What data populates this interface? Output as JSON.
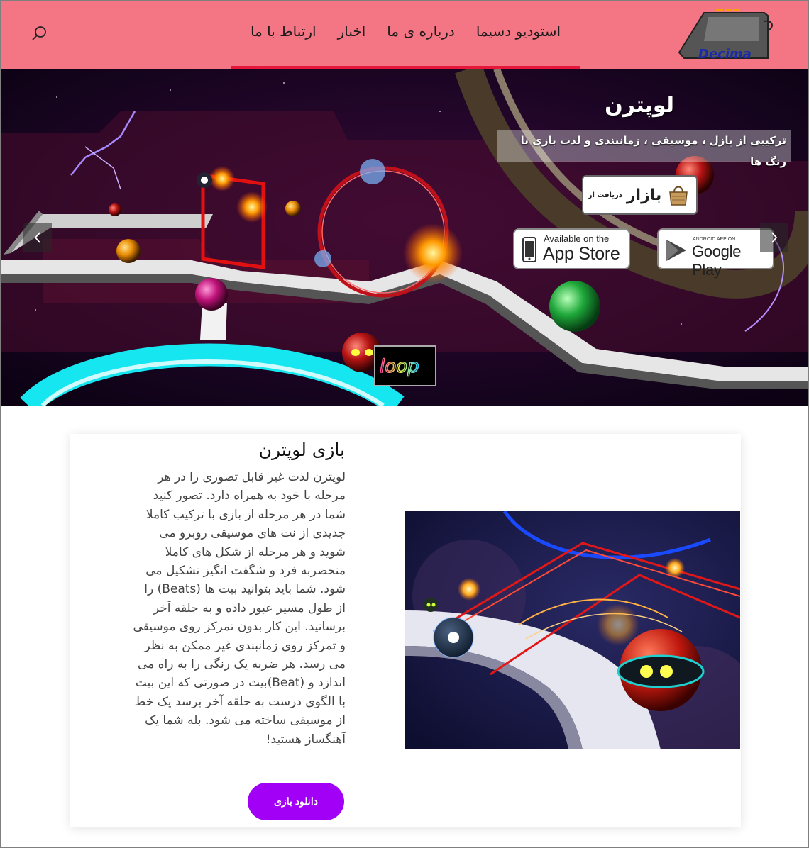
{
  "header": {
    "logo_text": "Decima",
    "nav": [
      {
        "label": "استودیو دسیما"
      },
      {
        "label": "درباره ی ما"
      },
      {
        "label": "اخبار"
      },
      {
        "label": "ارتباط با ما"
      }
    ]
  },
  "hero": {
    "title": "لوپترن",
    "subtitle": "ترکیبی از پازل ، موسیقی ، زمانبندی و لذت بازی با رنگ ها",
    "bazaar": {
      "small": "دریافت از",
      "big": "بازار"
    },
    "appstore": {
      "small": "Available on the",
      "big": "App Store"
    },
    "googleplay": {
      "small": "ANDROID APP ON",
      "big": "Google Play"
    },
    "loop_logo": "loop"
  },
  "content": {
    "title": "بازی لوپترن",
    "body": "لوپترن لذت غیر قابل تصوری را در هر مرحله با خود به همراه دارد. تصور کنید شما در هر مرحله از بازی با ترکیب کاملا جدیدی از نت های موسیقی روبرو می شوید و هر مرحله از شکل های کاملا منحصربه فرد و شگفت انگیز تشکیل می شود. شما باید بتوانید بیت ها (Beats) را از طول مسیر عبور داده و به حلقه آخر برسانید. این کار بدون تمرکز روی موسیقی و تمرکز روی زمانبندی غیر ممکن به نظر می رسد. هر ضربه یک رنگی را به راه می اندازد و (Beat)بیت در صورتی که این بیت با الگوی درست به حلقه آخر برسد یک خط از موسیقی ساخته می شود. بله شما یک آهنگساز هستید!",
    "download_label": "دانلود بازی"
  },
  "colors": {
    "header_bg": "#f47584",
    "nav_underline": "#e5173a",
    "button_bg": "#a200f6"
  },
  "icons": {
    "search": "search-icon",
    "prev": "chevron-left-icon",
    "next": "chevron-right-icon",
    "apple": "apple-icon",
    "play": "play-triangle-icon",
    "bag": "shopping-bag-icon"
  }
}
